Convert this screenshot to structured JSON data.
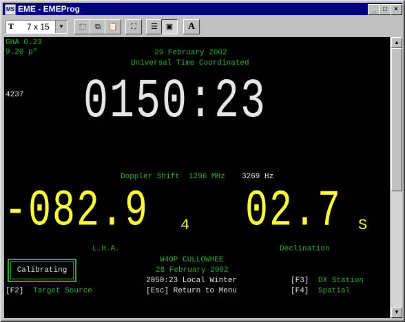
{
  "window": {
    "title": "EME - EMEProg",
    "icon": "ms-dos-icon"
  },
  "toolbar": {
    "font_size": "7 x 15",
    "font_icon_label": "T",
    "font_dialog_label": "A"
  },
  "screen": {
    "gha": "GHA 0.23",
    "gha2": "9.20 p\"",
    "counter": "4237",
    "date": "29 February 2002",
    "utc_label": "Universal Time Coordinated",
    "time": "0150:23",
    "doppler_label": "Doppler Shift  1296 MHz",
    "doppler_value": "3269 Hz",
    "lha": "-082.9",
    "lha_suffix": "4",
    "dec": "02.7",
    "dec_suffix": "S",
    "lha_label": "L.H.A.",
    "dec_label": "Declination",
    "station": "W40P CULLOWHEE",
    "station_date": "28 February 2002",
    "local_time": "2050:23 Local Winter",
    "f3_key": "[F3]",
    "f3_label": "DX Station",
    "f2_key": "[F2]",
    "f2_label": "Target Source",
    "esc_line": "[Esc] Return to Menu",
    "f4_key": "[F4]",
    "f4_label": "Spatial",
    "calibrating": "Calibrating"
  },
  "colors": {
    "green": "#2fb02f",
    "yellow": "#ffff40",
    "white": "#e8e8e8",
    "titlebar": "#000080"
  }
}
